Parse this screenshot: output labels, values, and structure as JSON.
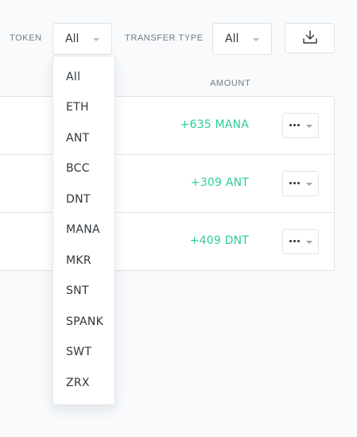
{
  "filters": {
    "token": {
      "label": "TOKEN",
      "selected": "All"
    },
    "transfer_type": {
      "label": "TRANSFER TYPE",
      "selected": "All"
    }
  },
  "export_icon": "download-icon",
  "table": {
    "amount_header": "AMOUNT",
    "rows": [
      {
        "amount": "+635 MANA"
      },
      {
        "amount": "+309 ANT"
      },
      {
        "amount": "+409 DNT"
      }
    ]
  },
  "token_options": [
    "All",
    "ETH",
    "ANT",
    "BCC",
    "DNT",
    "MANA",
    "MKR",
    "SNT",
    "SPANK",
    "SWT",
    "ZRX"
  ],
  "colors": {
    "positive_amount": "#2ccd9a",
    "border": "#dde4e9",
    "label": "#707b87"
  }
}
